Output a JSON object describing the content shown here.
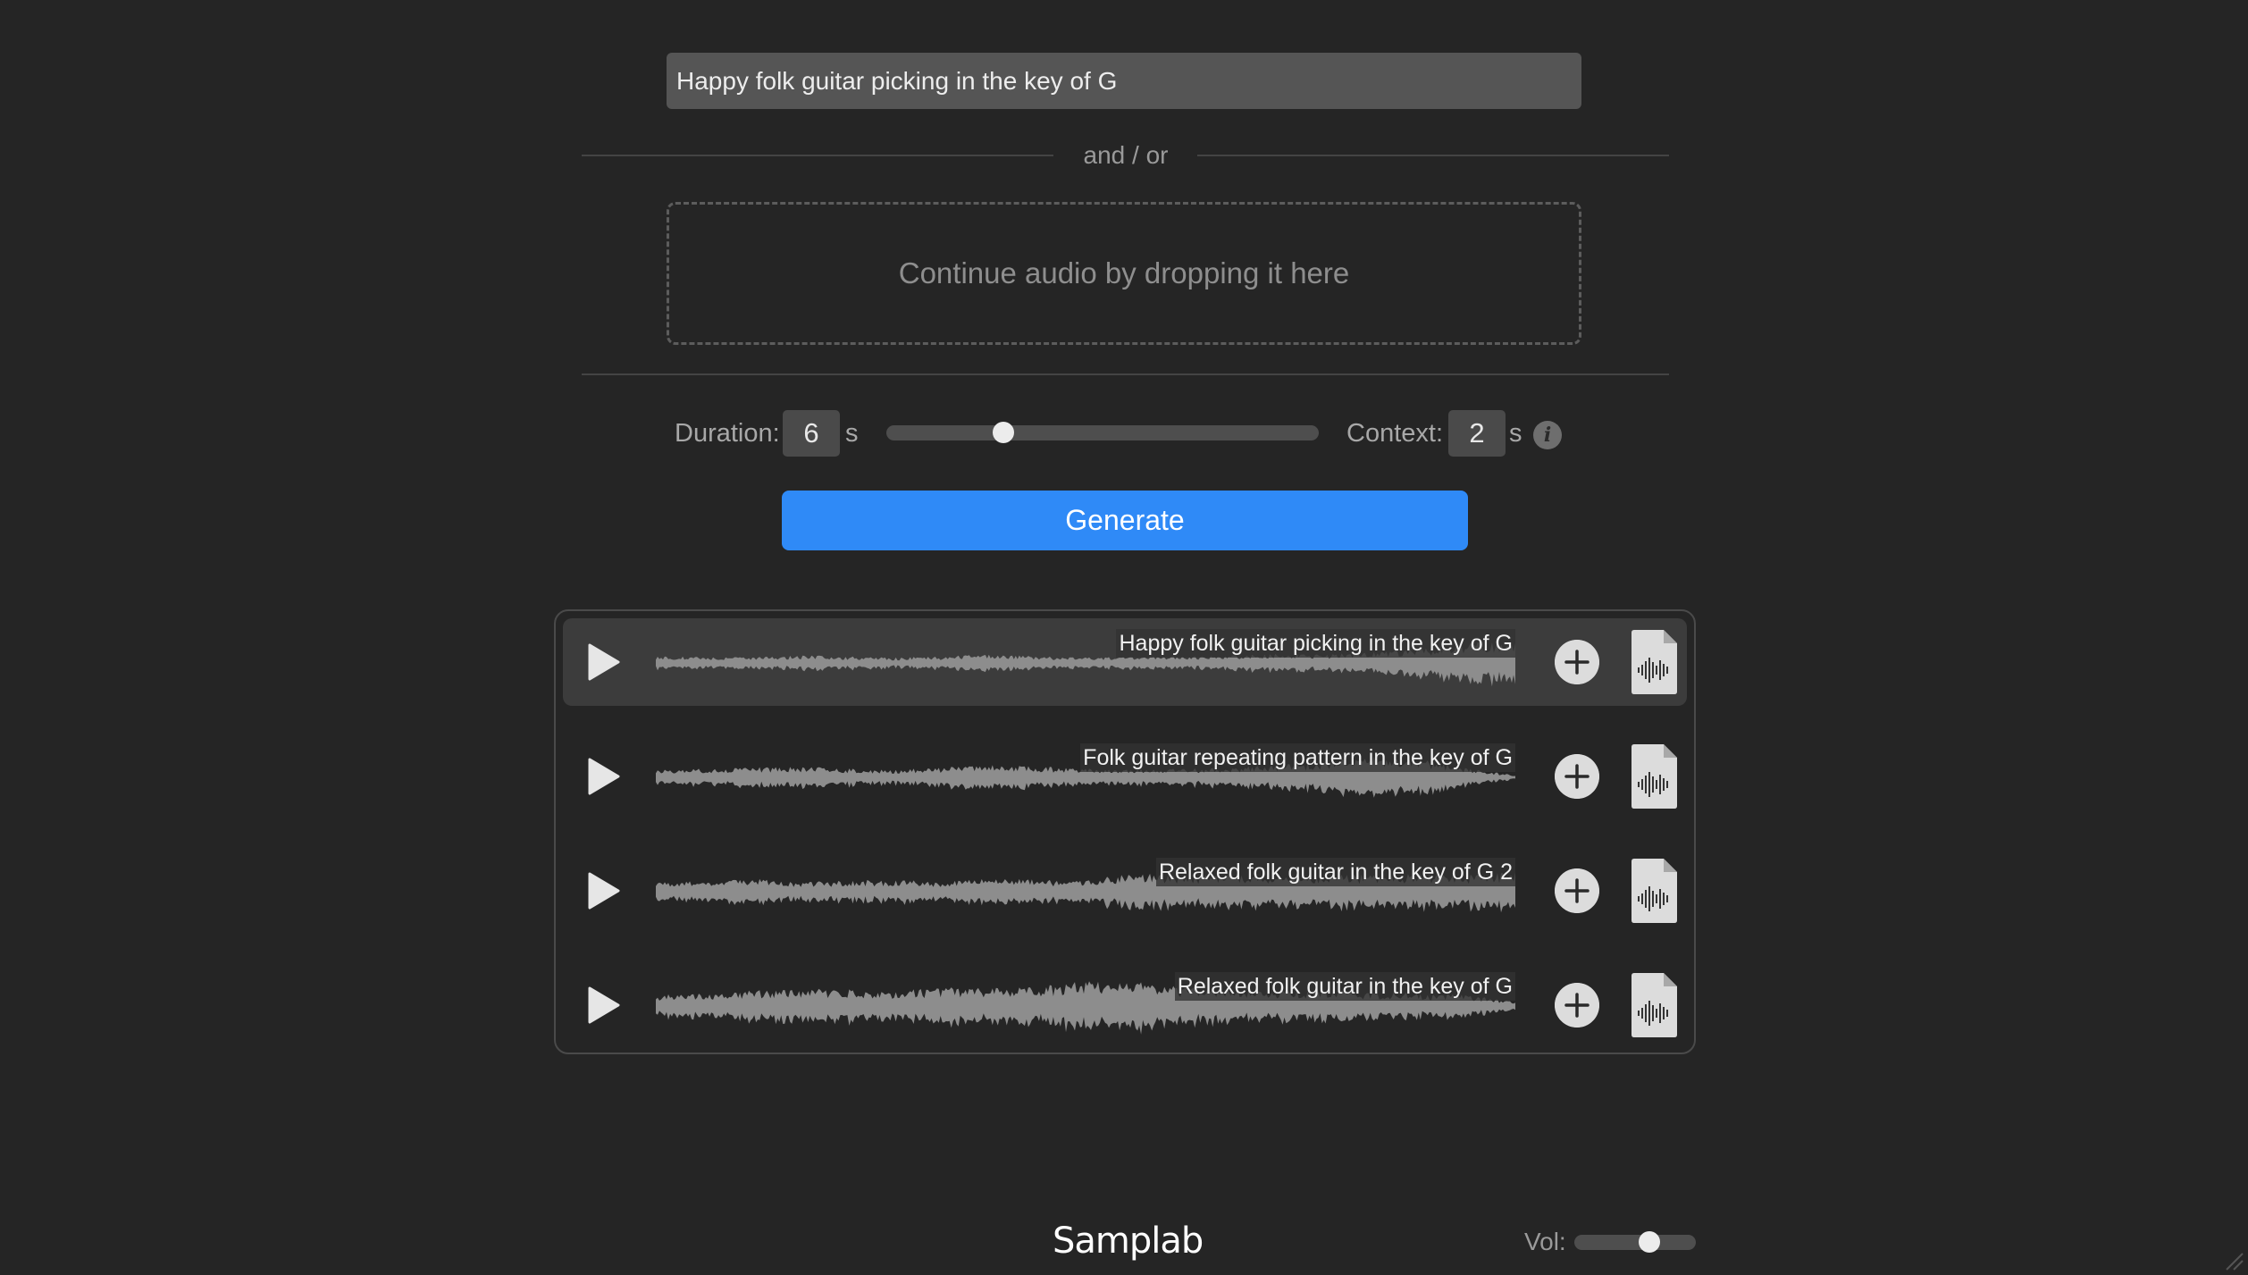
{
  "prompt": {
    "value": "Happy folk guitar picking in the key of G"
  },
  "divider_text": "and / or",
  "dropzone": {
    "label": "Continue audio by dropping it here"
  },
  "duration": {
    "label": "Duration:",
    "value": "6",
    "unit": "s",
    "slider_fraction": 0.27
  },
  "context": {
    "label": "Context:",
    "value": "2",
    "unit": "s",
    "info_glyph": "i"
  },
  "generate": {
    "label": "Generate",
    "color": "#2f8af7"
  },
  "results": [
    {
      "label": "Happy folk guitar picking in the key of G",
      "selected": true
    },
    {
      "label": "Folk guitar repeating pattern in the key of G",
      "selected": false
    },
    {
      "label": "Relaxed folk guitar in the key of G 2",
      "selected": false
    },
    {
      "label": "Relaxed folk guitar in the key of G",
      "selected": false
    }
  ],
  "footer": {
    "logo": "Samplab",
    "volume": {
      "label": "Vol:",
      "fraction": 0.62
    }
  },
  "icons": {
    "play": "play-icon",
    "add": "plus-icon",
    "file": "audio-file-icon",
    "info": "info-icon"
  }
}
